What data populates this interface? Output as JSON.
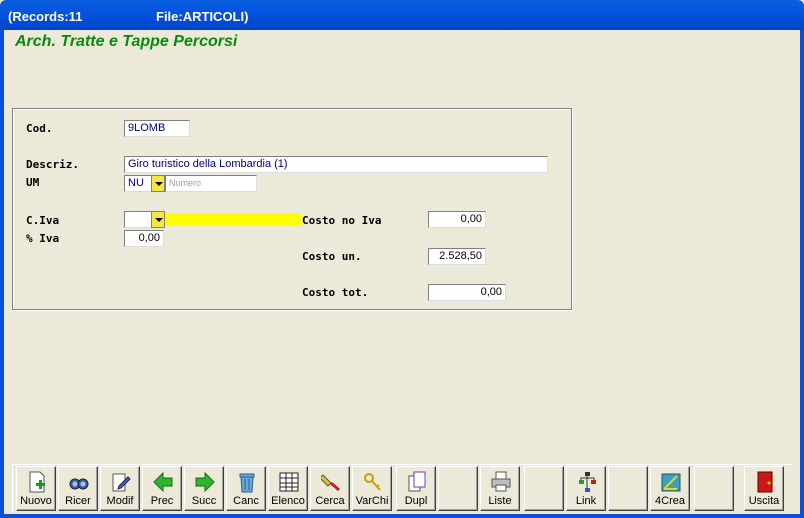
{
  "window": {
    "records": "(Records:11",
    "file": "File:ARTICOLI)"
  },
  "form": {
    "title": "Arch. Tratte e Tappe Percorsi",
    "cod_label": "Cod.",
    "cod_value": "9LOMB",
    "descr_label": "Descriz.",
    "descr_value": "Giro turistico della Lombardia  (1)",
    "um_label": "UM",
    "um_value": "NU",
    "um_placeholder": "Numero",
    "civa_label": "C.Iva",
    "civa_value": "",
    "piva_label": "% Iva",
    "piva_value": "0,00",
    "costo_noiva_label": "Costo no Iva",
    "costo_noiva_value": "0,00",
    "costo_un_label": "Costo un.",
    "costo_un_value": "2.528,50",
    "costo_tot_label": "Costo tot.",
    "costo_tot_value": "0,00"
  },
  "toolbar": {
    "nuovo": "Nuovo",
    "ricer": "Ricer",
    "modif": "Modif",
    "prec": "Prec",
    "succ": "Succ",
    "canc": "Canc",
    "elenco": "Elenco",
    "cerca": "Cerca",
    "varchi": "VarChi",
    "dupl": "Dupl",
    "liste": "Liste",
    "link": "Link",
    "crea": "4Crea",
    "uscita": "Uscita"
  }
}
